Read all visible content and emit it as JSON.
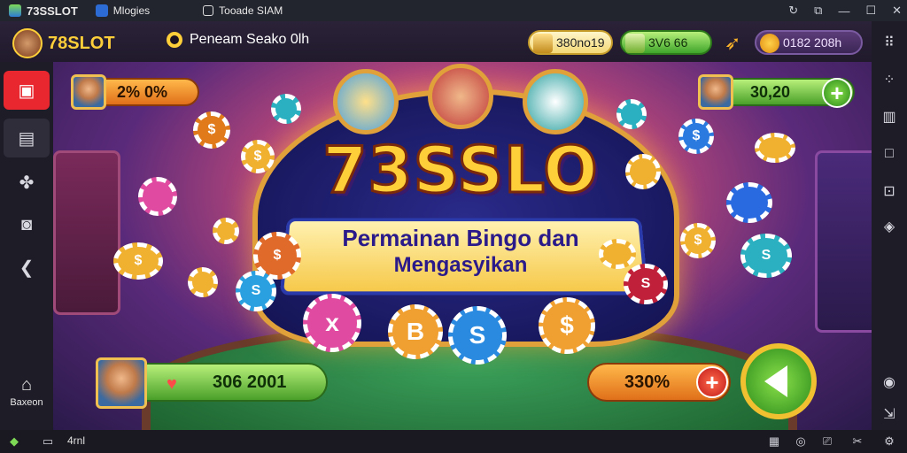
{
  "window": {
    "tabs": [
      {
        "label": "73SSLOT"
      },
      {
        "label": "Mlogies"
      },
      {
        "label": "Tooade SIAM"
      }
    ],
    "controls": [
      "back",
      "restore",
      "minimize",
      "maximize",
      "close"
    ]
  },
  "topbar": {
    "logo_text": "78SLOT",
    "game_name": "Peneam Seako 0lh",
    "currency_gold": "380no19",
    "currency_green": "3V6 66",
    "currency_coins": "0182 208h"
  },
  "sidebar": {
    "items": [
      "home",
      "news",
      "puzzle",
      "gamepad",
      "back"
    ],
    "bottom_label": "Baxeon"
  },
  "stage": {
    "title": "73SSLO",
    "subtitle_line1": "Permainan Bingo dan",
    "subtitle_line2": "Mengasyikan",
    "hud_top_left": "2% 0%",
    "hud_top_right": "30,20",
    "hud_bottom_left": "306 2001",
    "hud_bottom_right": "330%",
    "chips": [
      "x",
      "B",
      "S",
      "$"
    ]
  },
  "status": {
    "text": "4rnl"
  },
  "colors": {
    "accent_red": "#e8272f",
    "gold": "#ffcf3a",
    "green": "#4aa02a"
  }
}
